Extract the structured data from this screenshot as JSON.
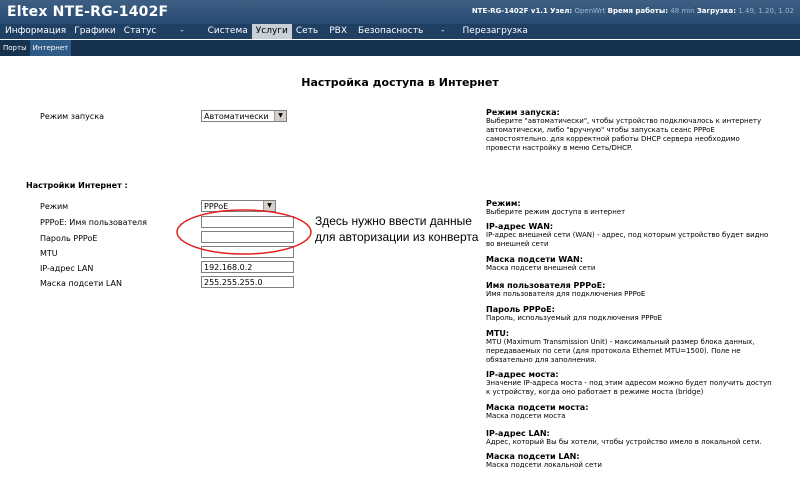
{
  "header": {
    "logo": "Eltex NTE-RG-1402F",
    "device": "NTE-RG-1402F v1.1",
    "node_label": "Узел:",
    "node_value": "OpenWrt",
    "uptime_label": "Время работы:",
    "uptime_value": "48 min",
    "load_label": "Загрузка:",
    "load_value": "1.49, 1.20, 1.02"
  },
  "mainnav": [
    {
      "label": "Информация"
    },
    {
      "label": "Графики"
    },
    {
      "label": "Статус"
    },
    {
      "label": "-"
    },
    {
      "label": "Система"
    },
    {
      "label": "Услуги"
    },
    {
      "label": "Сеть"
    },
    {
      "label": "PBX"
    },
    {
      "label": "Безопасность"
    },
    {
      "label": "-"
    },
    {
      "label": "Перезагрузка"
    }
  ],
  "subnav": [
    {
      "label": "Порты"
    },
    {
      "label": "Интернет"
    }
  ],
  "page": {
    "title": "Настройка доступа в Интернет",
    "startup_label": "Режим запуска",
    "startup_value": "Автоматически",
    "section_title": "Настройки Интернет :",
    "mode_label": "Режим",
    "mode_value": "PPPoE",
    "pppoe_user_label": "PPPoE: Имя пользователя",
    "pppoe_user_value": "",
    "pppoe_pass_label": "Пароль PPPoE",
    "pppoe_pass_value": "",
    "mtu_label": "MTU",
    "mtu_value": "",
    "lan_ip_label": "IP-адрес LAN",
    "lan_ip_value": "192.168.0.2",
    "lan_mask_label": "Маска подсети LAN",
    "lan_mask_value": "255.255.255.0"
  },
  "annotation": {
    "line1": "Здесь нужно ввести данные",
    "line2": "для авторизации из конверта"
  },
  "help": {
    "startup": {
      "title": "Режим запуска:",
      "text": "Выберите \"автоматически\", чтобы устройство подключалось к интернету автоматически, либо \"вручную\" чтобы запускать сеанс PPPoE самостоятельно. для корректной работы DHCP сервера необходимо провести настройку в меню Сеть/DHCP."
    },
    "mode": {
      "title": "Режим:",
      "text": "Выберите режим доступа в интернет"
    },
    "wan_ip": {
      "title": "IP-адрес WAN:",
      "text": "IP-адрес внешней сети (WAN) - адрес, под которым устройство будет видно во внешней сети"
    },
    "wan_mask": {
      "title": "Маска подсети WAN:",
      "text": "Маска подсети внешней сети"
    },
    "pppoe_user": {
      "title": "Имя пользователя PPPoE:",
      "text": "Имя пользователя для подключения PPPoE"
    },
    "pppoe_pass": {
      "title": "Пароль PPPoE:",
      "text": "Пароль, используемый для подключения PPPoE"
    },
    "mtu": {
      "title": "MTU:",
      "text": "MTU (Maximum Transmission Unit) - максимальный размер блока данных, передаваемых по сети (для протокола Ethernet MTU=1500). Поле не обязательно для заполнения."
    },
    "bridge_ip": {
      "title": "IP-адрес моста:",
      "text": "Значение IP-адреса моста - под этим адресом можно будет получить доступ к устройству, когда оно работает в режиме моста (bridge)"
    },
    "bridge_mask": {
      "title": "Маска подсети моста:",
      "text": "Маска подсети моста"
    },
    "lan_ip": {
      "title": "IP-адрес LAN:",
      "text": "Адрес, который Вы бы хотели, чтобы устройство имело в локальной сети."
    },
    "lan_mask": {
      "title": "Маска подсети LAN:",
      "text": "Маска подсети локальной сети"
    }
  },
  "colors": {
    "header_bg": "#2f5279",
    "nav_bg": "#1f3f63",
    "subnav_bg": "#17324f",
    "active_tab": "#c8cfd8",
    "annotation_oval": "#e02020"
  }
}
